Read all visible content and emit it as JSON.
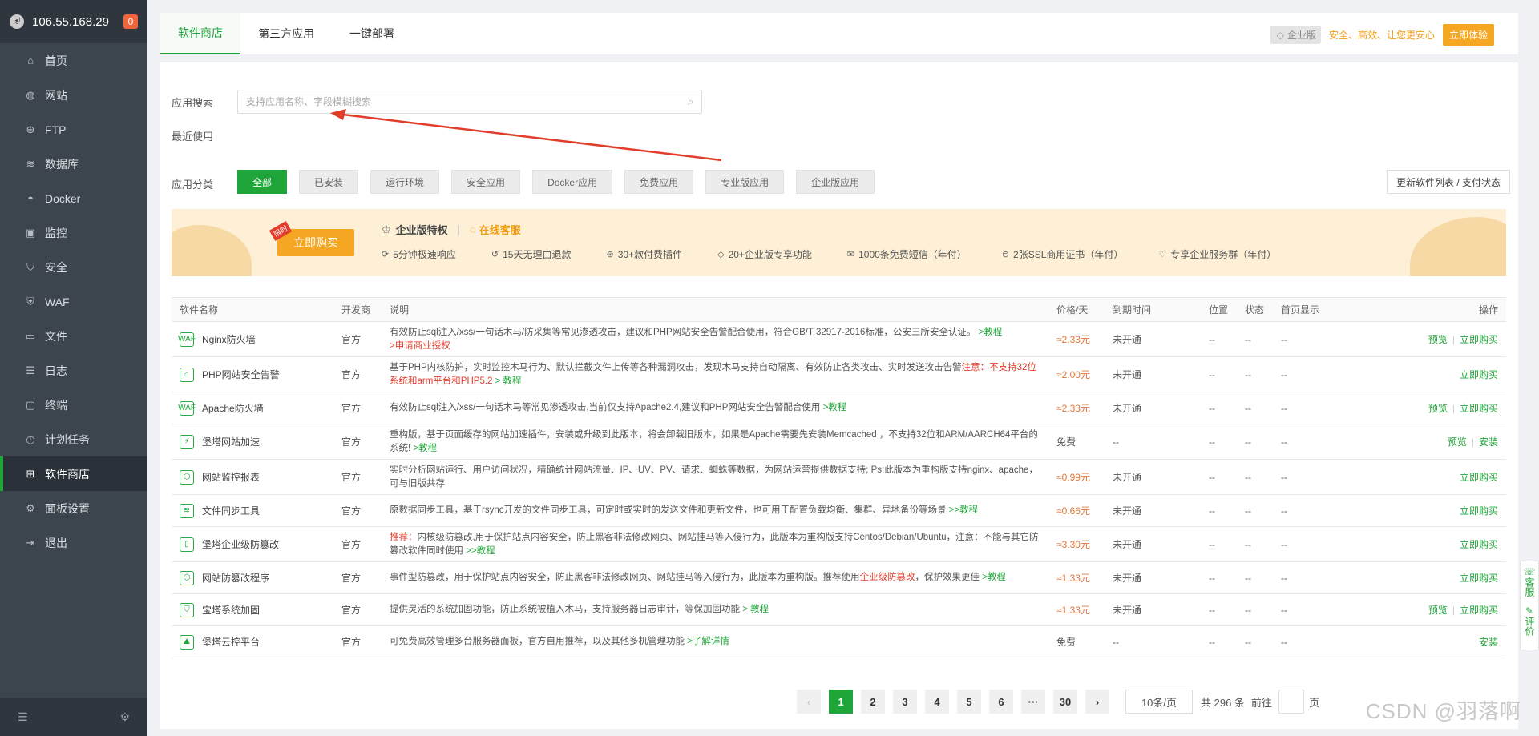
{
  "sidebar": {
    "ip": "106.55.168.29",
    "badge": "0",
    "items": [
      {
        "label": "首页",
        "icon": "home-icon"
      },
      {
        "label": "网站",
        "icon": "globe-icon"
      },
      {
        "label": "FTP",
        "icon": "ftp-icon"
      },
      {
        "label": "数据库",
        "icon": "database-icon"
      },
      {
        "label": "Docker",
        "icon": "docker-icon"
      },
      {
        "label": "监控",
        "icon": "monitor-icon"
      },
      {
        "label": "安全",
        "icon": "shield-icon"
      },
      {
        "label": "WAF",
        "icon": "waf-icon"
      },
      {
        "label": "文件",
        "icon": "folder-icon"
      },
      {
        "label": "日志",
        "icon": "log-icon"
      },
      {
        "label": "终端",
        "icon": "terminal-icon"
      },
      {
        "label": "计划任务",
        "icon": "clock-icon"
      },
      {
        "label": "软件商店",
        "icon": "grid-icon"
      },
      {
        "label": "面板设置",
        "icon": "settings-icon"
      },
      {
        "label": "退出",
        "icon": "logout-icon"
      }
    ]
  },
  "tabs": [
    "软件商店",
    "第三方应用",
    "一键部署"
  ],
  "promo": {
    "edition": "企业版",
    "slogan": "安全、高效、让您更安心",
    "try": "立即体验"
  },
  "search": {
    "label": "应用搜索",
    "placeholder": "支持应用名称、字段模糊搜索"
  },
  "recent_label": "最近使用",
  "category_label": "应用分类",
  "categories": [
    "全部",
    "已安装",
    "运行环境",
    "安全应用",
    "Docker应用",
    "免费应用",
    "专业版应用",
    "企业版应用"
  ],
  "refresh_label": "更新软件列表 / 支付状态",
  "banner": {
    "buy": "立即购买",
    "tag": "限时",
    "title": "企业版特权",
    "service": "在线客服",
    "features": [
      "5分钟极速响应",
      "15天无理由退款",
      "30+款付费插件",
      "20+企业版专享功能",
      "1000条免费短信（年付）",
      "2张SSL商用证书（年付）",
      "专享企业服务群（年付）"
    ]
  },
  "table": {
    "headers": [
      "软件名称",
      "开发商",
      "说明",
      "价格/天",
      "到期时间",
      "位置",
      "状态",
      "首页显示",
      "操作"
    ],
    "rows": [
      {
        "name": "Nginx防火墙",
        "dev": "官方",
        "desc": "有效防止sql注入/xss/一句话木马/防采集等常见渗透攻击，建议和PHP网站安全告警配合使用，符合GB/T 32917-2016标准，公安三所安全认证。",
        "desc_link": ">教程",
        "desc_red": ">申请商业授权",
        "price": "≈2.33元",
        "expire": "未开通",
        "loc": "--",
        "status": "--",
        "home": "--",
        "op1": "预览",
        "op2": "立即购买"
      },
      {
        "name": "PHP网站安全告警",
        "dev": "官方",
        "desc": "基于PHP内核防护，实时监控木马行为、默认拦截文件上传等各种漏洞攻击，发现木马支持自动隔离、有效防止各类攻击、实时发送攻击告警",
        "desc_red": "注意：不支持32位系统和arm平台和PHP5.2",
        "desc_link": "> 教程",
        "price": "≈2.00元",
        "expire": "未开通",
        "loc": "--",
        "status": "--",
        "home": "--",
        "op1": "",
        "op2": "立即购买"
      },
      {
        "name": "Apache防火墙",
        "dev": "官方",
        "desc": "有效防止sql注入/xss/一句话木马等常见渗透攻击,当前仅支持Apache2.4,建议和PHP网站安全告警配合使用",
        "desc_link": ">教程",
        "price": "≈2.33元",
        "expire": "未开通",
        "loc": "--",
        "status": "--",
        "home": "--",
        "op1": "预览",
        "op2": "立即购买"
      },
      {
        "name": "堡塔网站加速",
        "dev": "官方",
        "desc": "重构版，基于页面缓存的网站加速插件，安装或升级到此版本，将会卸载旧版本，如果是Apache需要先安装Memcached ，不支持32位和ARM/AARCH64平台的系统!",
        "desc_link": ">教程",
        "price": "免费",
        "expire": "--",
        "loc": "--",
        "status": "--",
        "home": "--",
        "op1": "预览",
        "op2": "安装"
      },
      {
        "name": "网站监控报表",
        "dev": "官方",
        "desc": "实时分析网站运行、用户访问状况，精确统计网站流量、IP、UV、PV、请求、蜘蛛等数据，为网站运营提供数据支持; Ps:此版本为重构版支持nginx、apache，可与旧版共存",
        "price": "≈0.99元",
        "expire": "未开通",
        "loc": "--",
        "status": "--",
        "home": "--",
        "op1": "",
        "op2": "立即购买"
      },
      {
        "name": "文件同步工具",
        "dev": "官方",
        "desc": "原数据同步工具，基于rsync开发的文件同步工具，可定时或实时的发送文件和更新文件，也可用于配置负载均衡、集群、异地备份等场景",
        "desc_link": ">>教程",
        "price": "≈0.66元",
        "expire": "未开通",
        "loc": "--",
        "status": "--",
        "home": "--",
        "op1": "",
        "op2": "立即购买"
      },
      {
        "name": "堡塔企业级防篡改",
        "dev": "官方",
        "desc_pre": "推荐：",
        "desc": "内核级防篡改,用于保护站点内容安全，防止黑客非法修改网页、网站挂马等入侵行为，此版本为重构版支持Centos/Debian/Ubuntu，注意：不能与其它防篡改软件同时使用",
        "desc_link": ">>教程",
        "price": "≈3.30元",
        "expire": "未开通",
        "loc": "--",
        "status": "--",
        "home": "--",
        "op1": "",
        "op2": "立即购买"
      },
      {
        "name": "网站防篡改程序",
        "dev": "官方",
        "desc": "事件型防篡改，用于保护站点内容安全，防止黑客非法修改网页、网站挂马等入侵行为，此版本为重构版。推荐使用",
        "desc_red": "企业级防篡改",
        "desc_post": "，保护效果更佳",
        "desc_link": ">教程",
        "price": "≈1.33元",
        "expire": "未开通",
        "loc": "--",
        "status": "--",
        "home": "--",
        "op1": "",
        "op2": "立即购买"
      },
      {
        "name": "宝塔系统加固",
        "dev": "官方",
        "desc": "提供灵活的系统加固功能，防止系统被植入木马，支持服务器日志审计，等保加固功能",
        "desc_link": "> 教程",
        "price": "≈1.33元",
        "expire": "未开通",
        "loc": "--",
        "status": "--",
        "home": "--",
        "op1": "预览",
        "op2": "立即购买"
      },
      {
        "name": "堡塔云控平台",
        "dev": "官方",
        "desc": "可免费高效管理多台服务器面板，官方自用推荐，以及其他多机管理功能",
        "desc_link": ">了解详情",
        "price": "免费",
        "expire": "--",
        "loc": "--",
        "status": "--",
        "home": "--",
        "op1": "",
        "op2": "安装"
      }
    ]
  },
  "pager": {
    "pages": [
      "1",
      "2",
      "3",
      "4",
      "5",
      "6",
      "···",
      "30"
    ],
    "per_page": "10条/页",
    "total": "共 296 条",
    "goto": "前往",
    "page_unit": "页"
  },
  "right_side": [
    "客服",
    "评价"
  ],
  "watermark": "CSDN @羽落啊",
  "colors": {
    "accent": "#20a53a",
    "price": "#e2793b",
    "warn": "#e23c2b",
    "promo": "#f5a623"
  }
}
